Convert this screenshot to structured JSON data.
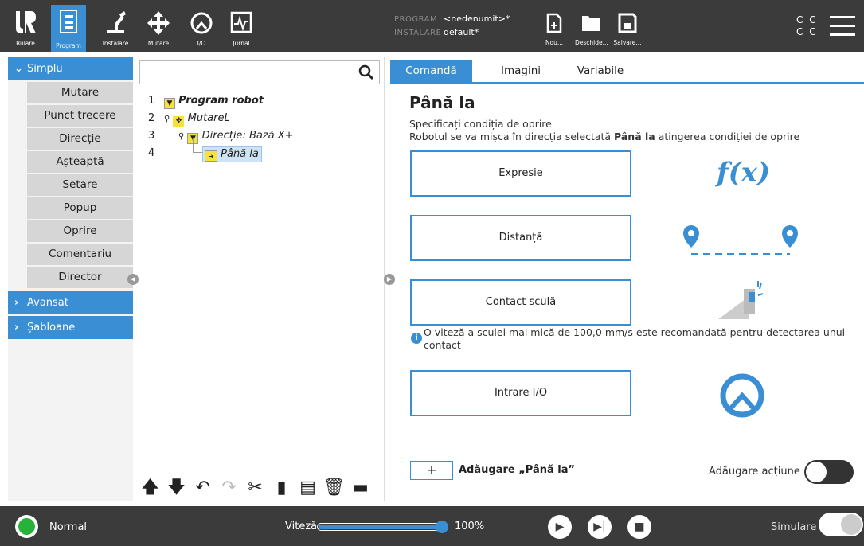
{
  "topbar": {
    "nav": [
      {
        "label": "Rulare"
      },
      {
        "label": "Program"
      },
      {
        "label": "Instalare"
      },
      {
        "label": "Mutare"
      },
      {
        "label": "I/O"
      },
      {
        "label": "Jurnal"
      }
    ],
    "program_key": "PROGRAM",
    "program_value": "<nedenumit>*",
    "install_key": "INSTALARE",
    "install_value": "default*",
    "file_buttons": [
      {
        "label": "Nou..."
      },
      {
        "label": "Deschide..."
      },
      {
        "label": "Salvare..."
      }
    ],
    "cc_top": "C C",
    "cc_bottom": "C C"
  },
  "sidebar": {
    "simplu_label": "Simplu",
    "items": [
      "Mutare",
      "Punct trecere",
      "Direcție",
      "Așteaptă",
      "Setare",
      "Popup",
      "Oprire",
      "Comentariu",
      "Director"
    ],
    "avansat_label": "Avansat",
    "sabloane_label": "Șabloane"
  },
  "tree": {
    "search_placeholder": "",
    "lines": [
      {
        "num": "1",
        "text": "Program robot"
      },
      {
        "num": "2",
        "text": "MutareL"
      },
      {
        "num": "3",
        "text": "Direcție: Bază X+"
      },
      {
        "num": "4",
        "text": "Până la"
      }
    ]
  },
  "tabs": [
    "Comandă",
    "Imagini",
    "Variabile"
  ],
  "content": {
    "title": "Până la",
    "desc1": "Specificați condiția de oprire",
    "desc2_pre": "Robotul se va mișca în direcția selectată ",
    "desc2_bold": "Până la",
    "desc2_post": " atingerea condiției de oprire",
    "options": [
      "Expresie",
      "Distanță",
      "Contact sculă",
      "Intrare I/O"
    ],
    "fx_label": "f(x)",
    "info_text": "O viteză a sculei mai mică de 100,0 mm/s este recomandată pentru detectarea unui contact",
    "add_button": "+",
    "add_label": "Adăugare „Până la”",
    "action_label": "Adăugare acțiune"
  },
  "bottombar": {
    "status": "Normal",
    "speed_label": "Viteză",
    "speed_value": "100%",
    "speed_fraction": 1.0,
    "sim_label": "Simulare"
  },
  "colors": {
    "accent": "#3a8fd4",
    "bar": "#3b3b3b",
    "status_ok": "#27b33a",
    "tree_yellow": "#f5e33b"
  }
}
